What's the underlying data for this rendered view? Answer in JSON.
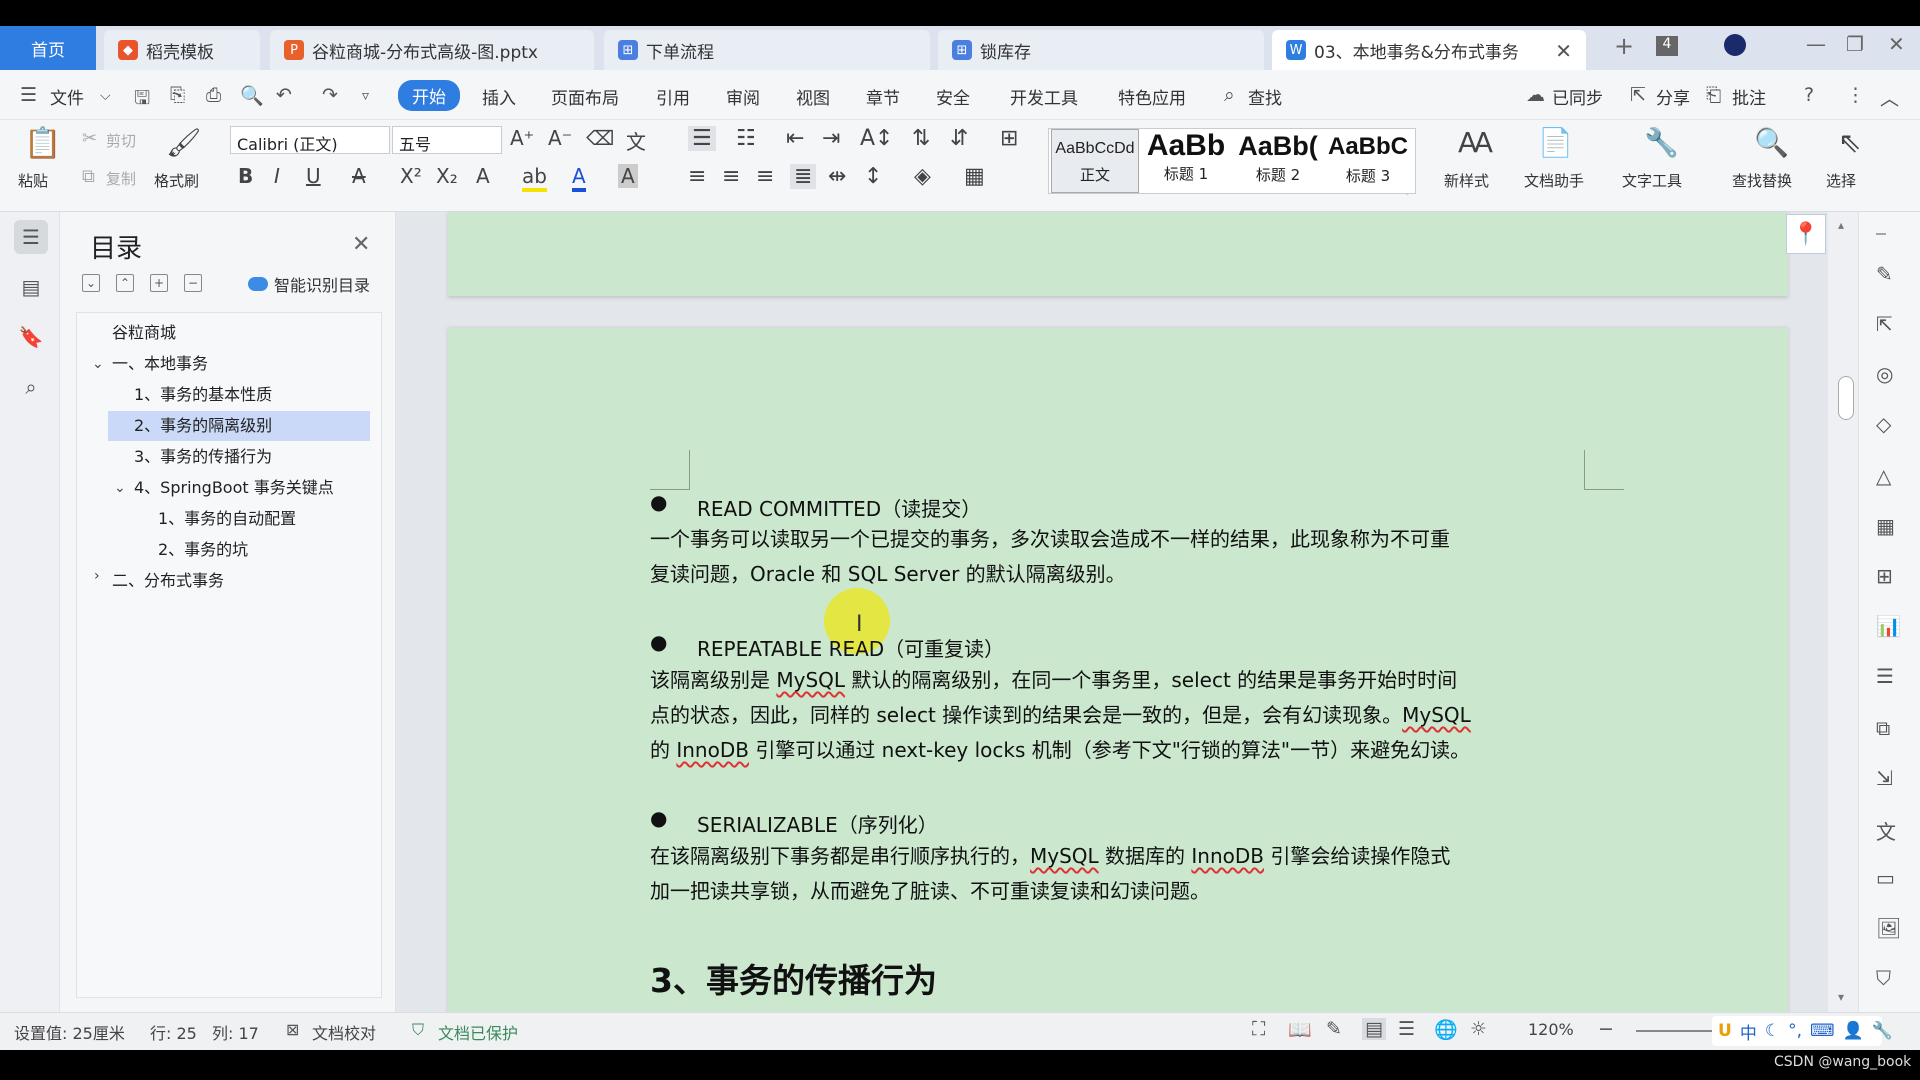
{
  "tabs": [
    {
      "label": "首页",
      "icon": "home"
    },
    {
      "label": "稻壳模板",
      "icon": "docer-icon"
    },
    {
      "label": "谷粒商城-分布式高级-图.pptx",
      "icon": "pptx-icon"
    },
    {
      "label": "下单流程",
      "icon": "flow-icon"
    },
    {
      "label": "锁库存",
      "icon": "flow-icon"
    },
    {
      "label": "03、本地事务&分布式事务",
      "icon": "word-icon"
    }
  ],
  "tab_count": "4",
  "menu": {
    "file": "文件",
    "items": [
      "开始",
      "插入",
      "页面布局",
      "引用",
      "审阅",
      "视图",
      "章节",
      "安全",
      "开发工具",
      "特色应用"
    ],
    "search": "查找",
    "synced": "已同步",
    "share": "分享",
    "comment": "批注"
  },
  "ribbon": {
    "paste": "粘贴",
    "cut": "剪切",
    "copy": "复制",
    "format_painter": "格式刷",
    "font": "Calibri (正文)",
    "size": "五号",
    "styles": [
      {
        "preview": "AaBbCcDd",
        "name": "正文"
      },
      {
        "preview": "AaBb",
        "name": "标题 1"
      },
      {
        "preview": "AaBb(",
        "name": "标题 2"
      },
      {
        "preview": "AaBbC",
        "name": "标题 3"
      }
    ],
    "new_style": "新样式",
    "doc_helper": "文档助手",
    "text_tools": "文字工具",
    "find_replace": "查找替换",
    "select": "选择"
  },
  "toc": {
    "title": "目录",
    "smart": "智能识别目录",
    "items": [
      {
        "label": "谷粒商城"
      },
      {
        "label": "一、本地事务"
      },
      {
        "label": "1、事务的基本性质"
      },
      {
        "label": "2、事务的隔离级别"
      },
      {
        "label": "3、事务的传播行为"
      },
      {
        "label": "4、SpringBoot 事务关键点"
      },
      {
        "label": "1、事务的自动配置"
      },
      {
        "label": "2、事务的坑"
      },
      {
        "label": "二、分布式事务"
      }
    ]
  },
  "doc": {
    "rc_head": "READ COMMITTED（读提交）",
    "rc_l1": "一个事务可以读取另一个已提交的事务，多次读取会造成不一样的结果，此现象称为不可重",
    "rc_l2": "复读问题，Oracle 和 SQL Server 的默认隔离级别。",
    "rr_head": "REPEATABLE READ（可重复读）",
    "rr_l1_a": "该隔离级别是 ",
    "rr_l1_b": "MySQL",
    "rr_l1_c": " 默认的隔离级别，在同一个事务里，select 的结果是事务开始时时间",
    "rr_l2": "点的状态，因此，同样的 select 操作读到的结果会是一致的，但是，会有幻读现象。",
    "rr_l2_b": "MySQL",
    "rr_l3_a": "的 ",
    "rr_l3_b": "InnoDB",
    "rr_l3_c": " 引擎可以通过 next-key locks 机制（参考下文\"行锁的算法\"一节）来避免幻读。",
    "se_head": "SERIALIZABLE（序列化）",
    "se_l1_a": "在该隔离级别下事务都是串行顺序执行的，",
    "se_l1_b": "MySQL",
    "se_l1_c": " 数据库的 ",
    "se_l1_d": "InnoDB",
    "se_l1_e": " 引擎会给读操作隐式",
    "se_l2": "加一把读共享锁，从而避免了脏读、不可重读复读和幻读问题。",
    "heading3": "3、事务的传播行为"
  },
  "status": {
    "setting": "设置值: 25厘米",
    "row": "行: 25",
    "col": "列: 17",
    "proof": "文档校对",
    "protected": "文档已保护",
    "zoom": "120%"
  },
  "ime": "中",
  "watermark": "CSDN @wang_book"
}
